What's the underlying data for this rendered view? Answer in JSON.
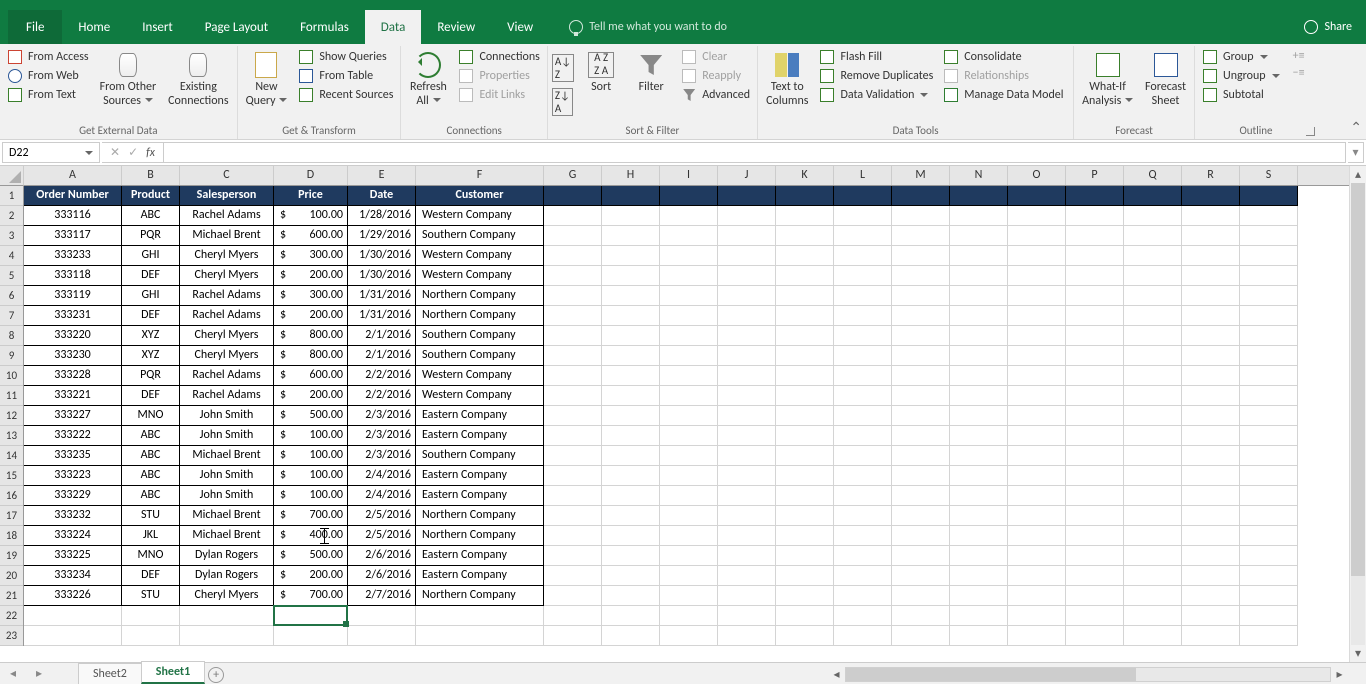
{
  "app": {
    "share": "Share"
  },
  "tabs": {
    "file": "File",
    "home": "Home",
    "insert": "Insert",
    "page_layout": "Page Layout",
    "formulas": "Formulas",
    "data": "Data",
    "review": "Review",
    "view": "View",
    "tell_me": "Tell me what you want to do"
  },
  "namebox": "D22",
  "formula": "",
  "ribbon": {
    "g1": {
      "title": "Get External Data",
      "from_access": "From Access",
      "from_web": "From Web",
      "from_text": "From Text",
      "other": "From Other",
      "other2": "Sources",
      "existing": "Existing",
      "existing2": "Connections"
    },
    "g2": {
      "title": "Get & Transform",
      "new": "New",
      "new2": "Query",
      "show_q": "Show Queries",
      "from_table": "From Table",
      "recent": "Recent Sources"
    },
    "g3": {
      "title": "Connections",
      "refresh": "Refresh",
      "refresh2": "All",
      "conn": "Connections",
      "prop": "Properties",
      "edit": "Edit Links"
    },
    "g4": {
      "title": "Sort & Filter",
      "sort": "Sort",
      "filter": "Filter",
      "clear": "Clear",
      "reapply": "Reapply",
      "adv": "Advanced"
    },
    "g5": {
      "title": "Data Tools",
      "ttc": "Text to",
      "ttc2": "Columns",
      "flash": "Flash Fill",
      "remdup": "Remove Duplicates",
      "datav": "Data Validation",
      "consol": "Consolidate",
      "rel": "Relationships",
      "mdm": "Manage Data Model"
    },
    "g6": {
      "title": "Forecast",
      "wia": "What-If",
      "wia2": "Analysis",
      "fs": "Forecast",
      "fs2": "Sheet"
    },
    "g7": {
      "title": "Outline",
      "group": "Group",
      "ungroup": "Ungroup",
      "subt": "Subtotal"
    }
  },
  "columns": [
    "A",
    "B",
    "C",
    "D",
    "E",
    "F",
    "G",
    "H",
    "I",
    "J",
    "K",
    "L",
    "M",
    "N",
    "O",
    "P",
    "Q",
    "R",
    "S"
  ],
  "headers": [
    "Order Number",
    "Product",
    "Salesperson",
    "Price",
    "Date",
    "Customer"
  ],
  "rows": [
    {
      "n": "333116",
      "p": "ABC",
      "s": "Rachel Adams",
      "pr": "100.00",
      "d": "1/28/2016",
      "c": "Western Company"
    },
    {
      "n": "333117",
      "p": "PQR",
      "s": "Michael Brent",
      "pr": "600.00",
      "d": "1/29/2016",
      "c": "Southern Company"
    },
    {
      "n": "333233",
      "p": "GHI",
      "s": "Cheryl Myers",
      "pr": "300.00",
      "d": "1/30/2016",
      "c": "Western Company"
    },
    {
      "n": "333118",
      "p": "DEF",
      "s": "Cheryl Myers",
      "pr": "200.00",
      "d": "1/30/2016",
      "c": "Western Company"
    },
    {
      "n": "333119",
      "p": "GHI",
      "s": "Rachel Adams",
      "pr": "300.00",
      "d": "1/31/2016",
      "c": "Northern Company"
    },
    {
      "n": "333231",
      "p": "DEF",
      "s": "Rachel Adams",
      "pr": "200.00",
      "d": "1/31/2016",
      "c": "Northern Company"
    },
    {
      "n": "333220",
      "p": "XYZ",
      "s": "Cheryl Myers",
      "pr": "800.00",
      "d": "2/1/2016",
      "c": "Southern Company"
    },
    {
      "n": "333230",
      "p": "XYZ",
      "s": "Cheryl Myers",
      "pr": "800.00",
      "d": "2/1/2016",
      "c": "Southern Company"
    },
    {
      "n": "333228",
      "p": "PQR",
      "s": "Rachel Adams",
      "pr": "600.00",
      "d": "2/2/2016",
      "c": "Western Company"
    },
    {
      "n": "333221",
      "p": "DEF",
      "s": "Rachel Adams",
      "pr": "200.00",
      "d": "2/2/2016",
      "c": "Western Company"
    },
    {
      "n": "333227",
      "p": "MNO",
      "s": "John Smith",
      "pr": "500.00",
      "d": "2/3/2016",
      "c": "Eastern Company"
    },
    {
      "n": "333222",
      "p": "ABC",
      "s": "John Smith",
      "pr": "100.00",
      "d": "2/3/2016",
      "c": "Eastern Company"
    },
    {
      "n": "333235",
      "p": "ABC",
      "s": "Michael Brent",
      "pr": "100.00",
      "d": "2/3/2016",
      "c": "Southern Company"
    },
    {
      "n": "333223",
      "p": "ABC",
      "s": "John Smith",
      "pr": "100.00",
      "d": "2/4/2016",
      "c": "Eastern Company"
    },
    {
      "n": "333229",
      "p": "ABC",
      "s": "John Smith",
      "pr": "100.00",
      "d": "2/4/2016",
      "c": "Eastern Company"
    },
    {
      "n": "333232",
      "p": "STU",
      "s": "Michael Brent",
      "pr": "700.00",
      "d": "2/5/2016",
      "c": "Northern Company"
    },
    {
      "n": "333224",
      "p": "JKL",
      "s": "Michael Brent",
      "pr": "400.00",
      "d": "2/5/2016",
      "c": "Northern Company"
    },
    {
      "n": "333225",
      "p": "MNO",
      "s": "Dylan Rogers",
      "pr": "500.00",
      "d": "2/6/2016",
      "c": "Eastern Company"
    },
    {
      "n": "333234",
      "p": "DEF",
      "s": "Dylan Rogers",
      "pr": "200.00",
      "d": "2/6/2016",
      "c": "Eastern Company"
    },
    {
      "n": "333226",
      "p": "STU",
      "s": "Cheryl Myers",
      "pr": "700.00",
      "d": "2/7/2016",
      "c": "Northern Company"
    }
  ],
  "sheets": {
    "s2": "Sheet2",
    "s1": "Sheet1"
  },
  "col_widths": {
    "A": 98,
    "B": 58,
    "C": 94,
    "D": 74,
    "E": 68,
    "F": 128,
    "rest": 58
  },
  "visible_row_count": 23,
  "currency_sym": "$"
}
